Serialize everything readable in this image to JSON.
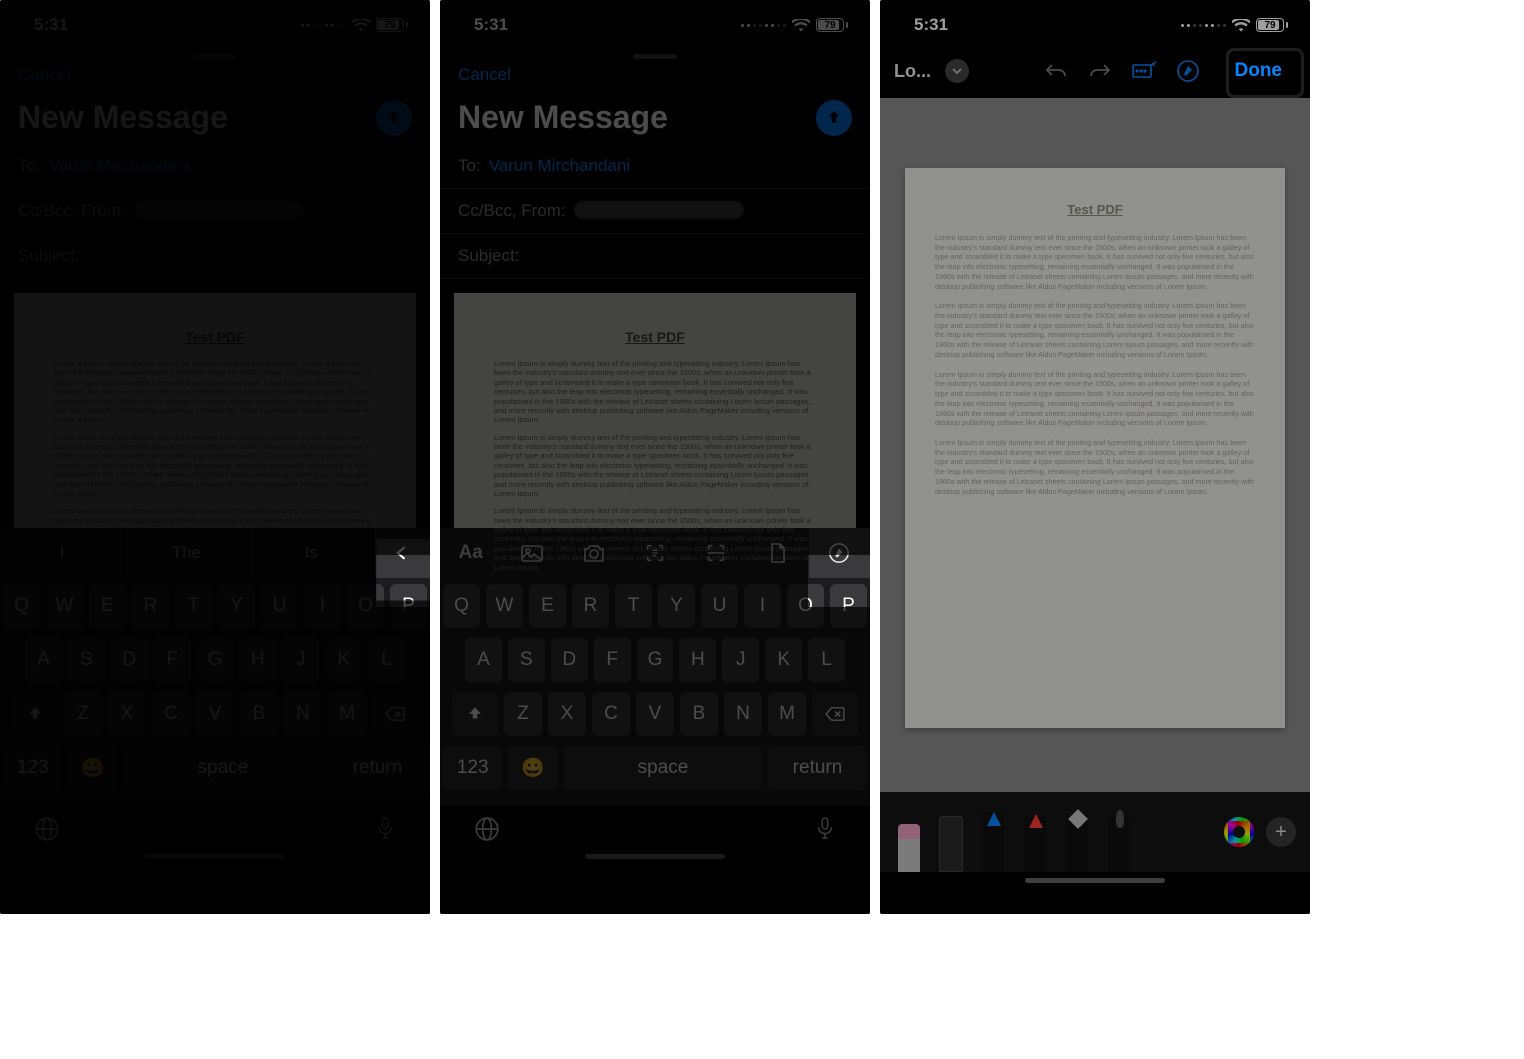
{
  "status": {
    "time": "5:31",
    "battery": "79"
  },
  "mail": {
    "cancel": "Cancel",
    "title": "New Message",
    "to_label": "To:",
    "to_value": "Varun Mirchandani",
    "ccbcc_label": "Cc/Bcc, From:",
    "subject_label": "Subject:",
    "doc_title": "Test PDF",
    "lorem": "Lorem Ipsum is simply dummy text of the printing and typesetting industry. Lorem Ipsum has been the industry's standard dummy text ever since the 1500s, when an unknown printer took a galley of type and scrambled it to make a type specimen book. It has survived not only five centuries, but also the leap into electronic typesetting, remaining essentially unchanged. It was popularised in the 1960s with the release of Letraset sheets containing Lorem Ipsum passages, and more recently with desktop publishing software like Aldus PageMaker including versions of Lorem Ipsum."
  },
  "suggestions": [
    "I",
    "The",
    "Is"
  ],
  "keyboard": {
    "row1": [
      "Q",
      "W",
      "E",
      "R",
      "T",
      "Y",
      "U",
      "I",
      "O",
      "P"
    ],
    "row2": [
      "A",
      "S",
      "D",
      "F",
      "G",
      "H",
      "J",
      "K",
      "L"
    ],
    "row3": [
      "Z",
      "X",
      "C",
      "V",
      "B",
      "N",
      "M"
    ],
    "numkey": "123",
    "space": "space",
    "return": "return"
  },
  "markup": {
    "back": "Lo...",
    "done": "Done",
    "add": "+"
  }
}
